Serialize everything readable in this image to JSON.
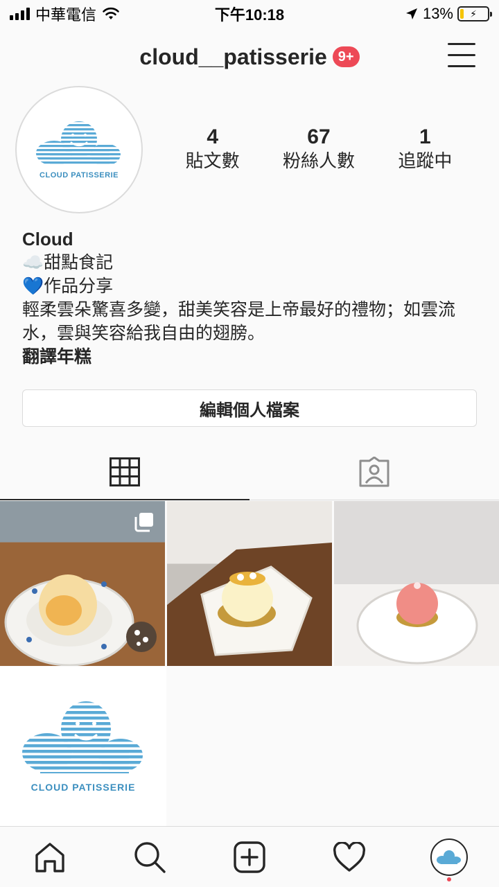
{
  "status_bar": {
    "carrier": "中華電信",
    "time": "下午10:18",
    "battery_percent": "13%",
    "battery_level": 0.13,
    "icons": [
      "signal-icon",
      "wifi-icon",
      "location-arrow-icon",
      "battery-charging-icon"
    ]
  },
  "header": {
    "username": "cloud__patisserie",
    "notification_badge": "9+",
    "menu_icon": "hamburger-menu-icon"
  },
  "profile": {
    "avatar_brand": "CLOUD PATISSERIE",
    "stats": [
      {
        "value": "4",
        "label": "貼文數"
      },
      {
        "value": "67",
        "label": "粉絲人數"
      },
      {
        "value": "1",
        "label": "追蹤中"
      }
    ]
  },
  "bio": {
    "name": "Cloud",
    "line1": "☁️甜點食記",
    "line2": "💙作品分享",
    "description": "輕柔雲朵驚喜多變，甜美笑容是上帝最好的禮物；如雲流水，雲與笑容給我自由的翅膀。",
    "translate": "翻譯年糕"
  },
  "edit_profile_button": "編輯個人檔案",
  "tabs": [
    {
      "icon": "grid-icon",
      "active": true
    },
    {
      "icon": "tagged-person-icon",
      "active": false
    }
  ],
  "posts": [
    {
      "type": "carousel",
      "icon": "multiple-photos-icon"
    },
    {
      "type": "photo"
    },
    {
      "type": "photo"
    }
  ],
  "story_tile": {
    "brand": "CLOUD PATISSERIE"
  },
  "bottom_nav": [
    "home-icon",
    "search-icon",
    "new-post-icon",
    "activity-heart-icon",
    "profile-avatar-icon"
  ],
  "colors": {
    "accent_badge": "#ed4956",
    "brand_blue": "#3c8fbf",
    "text": "#262626",
    "border": "#dbdbdb"
  }
}
